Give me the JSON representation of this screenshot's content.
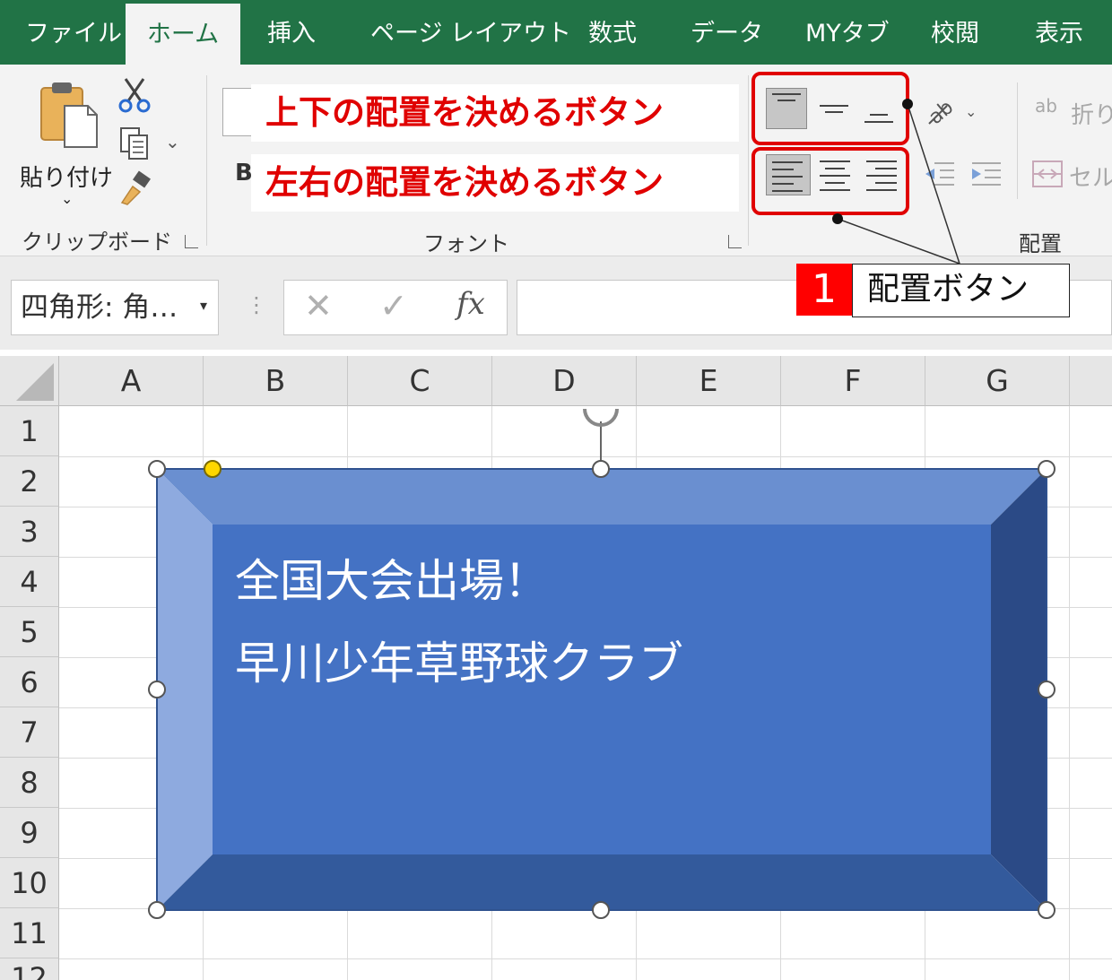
{
  "tabs": [
    {
      "label": "ファイル",
      "active": false
    },
    {
      "label": "ホーム",
      "active": true
    },
    {
      "label": "挿入",
      "active": false
    },
    {
      "label": "ページ レイアウト",
      "active": false
    },
    {
      "label": "数式",
      "active": false
    },
    {
      "label": "データ",
      "active": false
    },
    {
      "label": "MYタブ",
      "active": false
    },
    {
      "label": "校閲",
      "active": false
    },
    {
      "label": "表示",
      "active": false
    }
  ],
  "ribbon": {
    "clipboard": {
      "paste_label": "貼り付け",
      "group_label": "クリップボード"
    },
    "font": {
      "group_label": "フォント",
      "bold_letter": "B"
    },
    "alignment": {
      "group_label": "配置",
      "wrap_label": "折り",
      "merge_label": "セル"
    }
  },
  "annotations": {
    "vertical_callout": "上下の配置を決めるボタン",
    "horizontal_callout": "左右の配置を決めるボタン",
    "badge_number": "1",
    "badge_label": "配置ボタン"
  },
  "formula_bar": {
    "name_box": "四角形: 角…",
    "fx_label": "fx",
    "value": ""
  },
  "columns": [
    "A",
    "B",
    "C",
    "D",
    "E",
    "F",
    "G"
  ],
  "rows": [
    "1",
    "2",
    "3",
    "4",
    "5",
    "6",
    "7",
    "8",
    "9",
    "10",
    "11",
    "12"
  ],
  "shape": {
    "line1": "全国大会出場！",
    "line2": "早川少年草野球クラブ",
    "colors": {
      "face": "#4472c4",
      "top": "#6a8fd0",
      "left": "#8eaadf",
      "right": "#2b4a86",
      "bottom": "#335a9c"
    }
  },
  "colors": {
    "excel_green": "#217346",
    "callout_red": "#e00000"
  }
}
